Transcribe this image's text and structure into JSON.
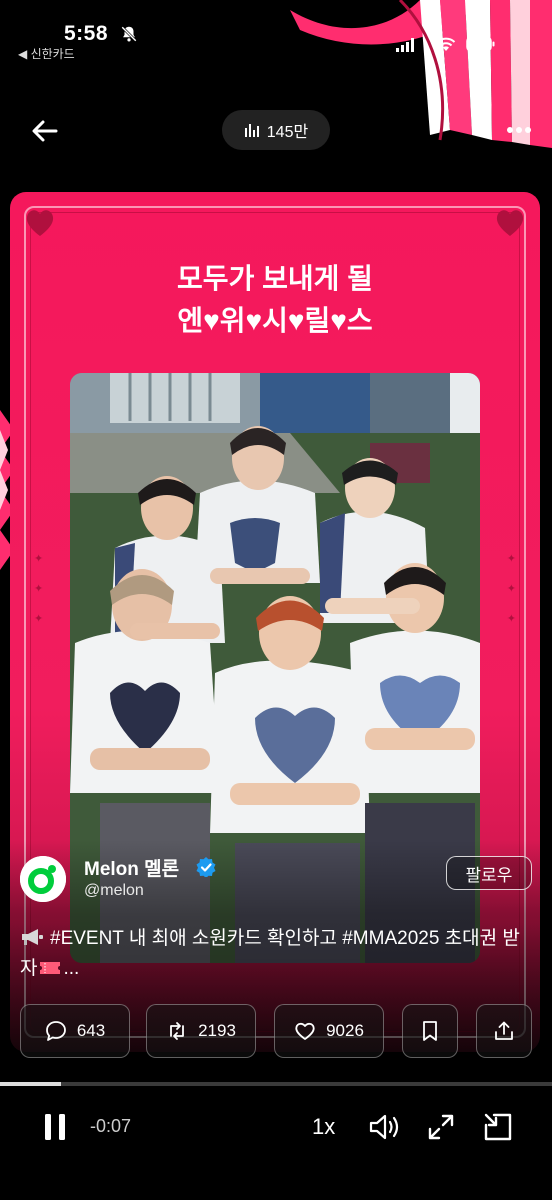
{
  "status_bar": {
    "time": "5:58",
    "back_app": "◀ 신한카드"
  },
  "nav": {
    "views": "145만"
  },
  "card": {
    "title_line1": "모두가 보내게 될",
    "title_line2": "엔♥위♥시♥릴♥스"
  },
  "post": {
    "author_name": "Melon 멜론",
    "author_handle": "@melon",
    "follow_label": "팔로우",
    "text": "#EVENT 내 최애 소원카드 확인하고 #MMA2025 초대권 받자",
    "text_suffix": "..."
  },
  "actions": {
    "replies": "643",
    "reposts": "2193",
    "likes": "9026"
  },
  "player": {
    "time_remaining": "-0:07",
    "speed": "1x",
    "progress": 0.11
  },
  "colors": {
    "card_pink": "#f5185c",
    "verified_blue": "#1d9bf0",
    "melon_green": "#00cd3c"
  }
}
